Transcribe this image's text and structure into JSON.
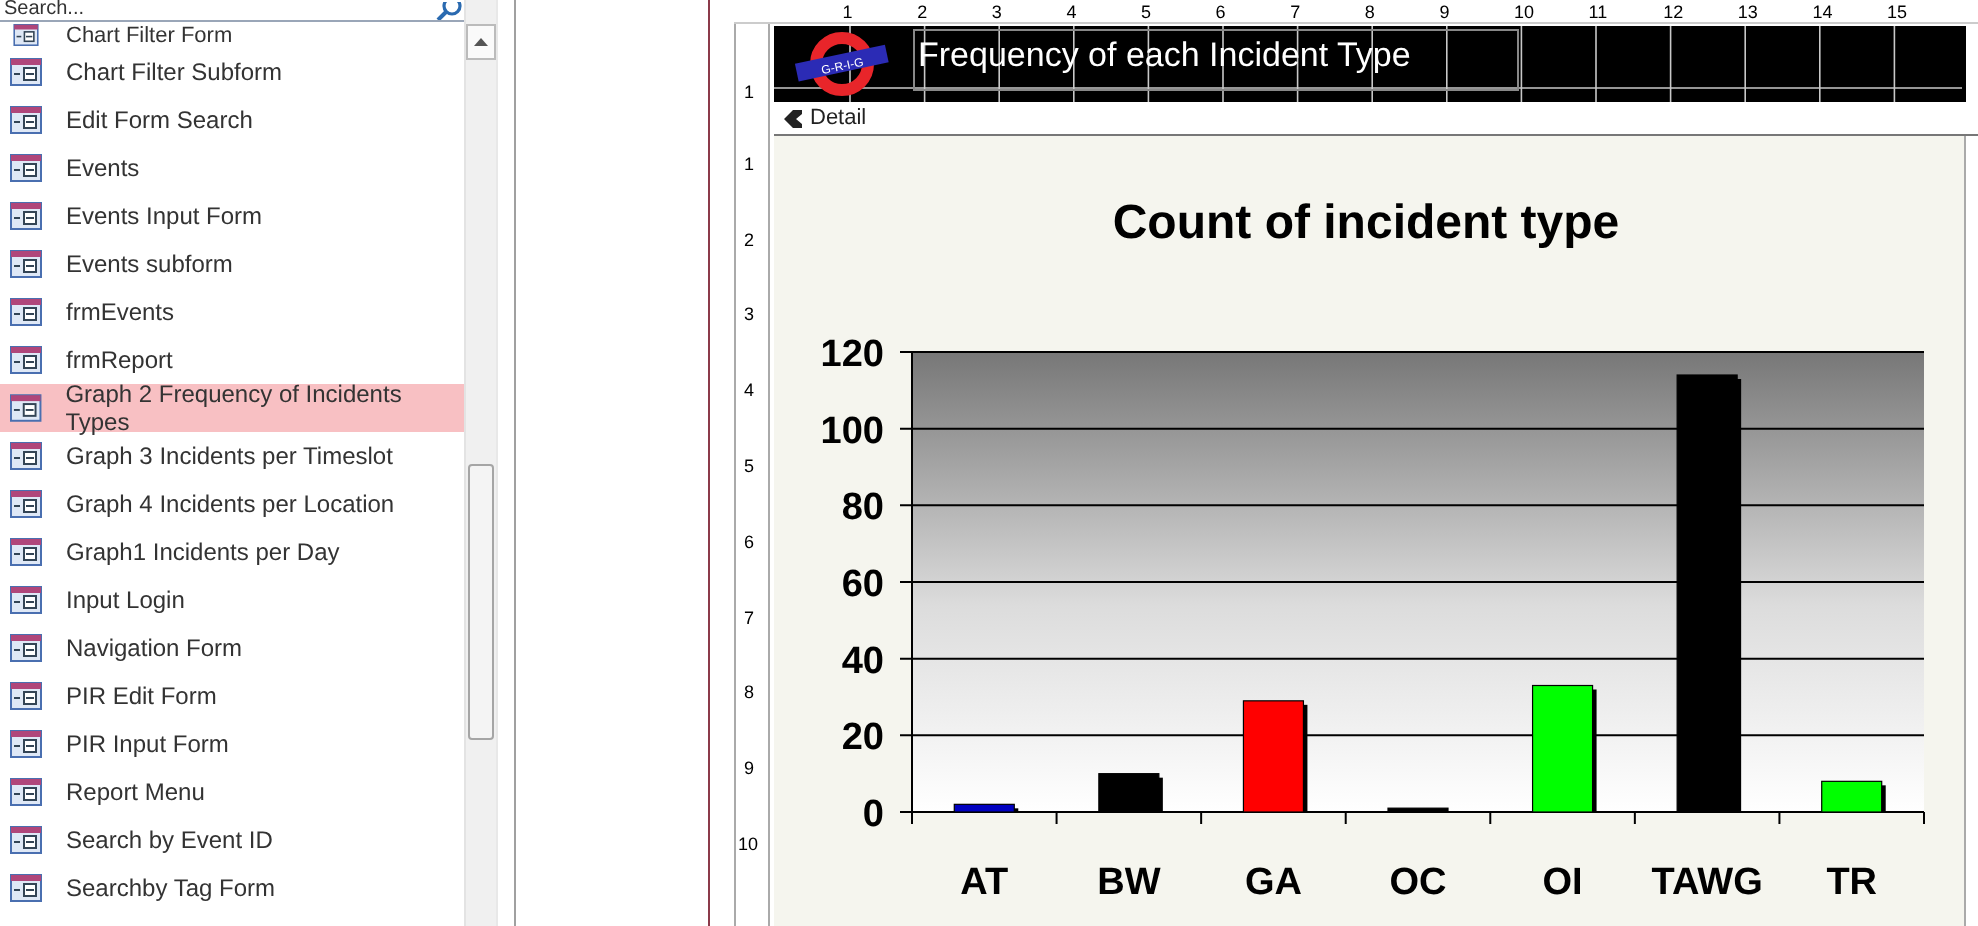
{
  "navigation_pane": {
    "search": {
      "placeholder": "Search..."
    },
    "items": [
      {
        "label": "Chart Filter Form",
        "selected": false
      },
      {
        "label": "Chart Filter Subform",
        "selected": false
      },
      {
        "label": "Edit Form Search",
        "selected": false
      },
      {
        "label": "Events",
        "selected": false
      },
      {
        "label": "Events Input Form",
        "selected": false
      },
      {
        "label": "Events subform",
        "selected": false
      },
      {
        "label": "frmEvents",
        "selected": false
      },
      {
        "label": "frmReport",
        "selected": false
      },
      {
        "label": "Graph 2 Frequency of Incidents Types",
        "selected": true
      },
      {
        "label": "Graph 3 Incidents per Timeslot",
        "selected": false
      },
      {
        "label": "Graph 4 Incidents per Location",
        "selected": false
      },
      {
        "label": "Graph1 Incidents per Day",
        "selected": false
      },
      {
        "label": "Input Login",
        "selected": false
      },
      {
        "label": "Navigation Form",
        "selected": false
      },
      {
        "label": "PIR Edit Form",
        "selected": false
      },
      {
        "label": "PIR Input Form",
        "selected": false
      },
      {
        "label": "Report Menu",
        "selected": false
      },
      {
        "label": "Search by Event ID",
        "selected": false
      },
      {
        "label": "Searchby Tag Form",
        "selected": false
      }
    ]
  },
  "designer": {
    "horizontal_ruler": [
      "1",
      "2",
      "3",
      "4",
      "5",
      "6",
      "7",
      "8",
      "9",
      "10",
      "11",
      "12",
      "13",
      "14",
      "15"
    ],
    "vertical_ruler_header": [
      "1"
    ],
    "vertical_ruler_detail": [
      "1",
      "2",
      "3",
      "4",
      "5",
      "6",
      "7",
      "8",
      "9",
      "10"
    ],
    "header": {
      "logo_text": "G-R-I-G",
      "title": "Frequency of each Incident Type"
    },
    "detail_section": {
      "label": "Detail",
      "chart_data": {
        "type": "bar",
        "title": "Count of incident type",
        "categories": [
          "AT",
          "BW",
          "GA",
          "OC",
          "OI",
          "TAWG",
          "TR"
        ],
        "series": [
          {
            "color": "#0000c0",
            "values": [
              2,
              null,
              null,
              null,
              null,
              null,
              null
            ]
          },
          {
            "color": "#000000",
            "values": [
              null,
              10,
              null,
              1,
              null,
              114,
              null
            ]
          },
          {
            "color": "#ff0000",
            "values": [
              null,
              null,
              29,
              null,
              null,
              null,
              null
            ]
          },
          {
            "color": "#00ff00",
            "values": [
              null,
              null,
              null,
              null,
              33,
              null,
              8
            ]
          }
        ],
        "grid": true,
        "ylim": [
          0,
          120
        ],
        "yticks": [
          0,
          20,
          40,
          60,
          80,
          100,
          120
        ]
      }
    }
  }
}
